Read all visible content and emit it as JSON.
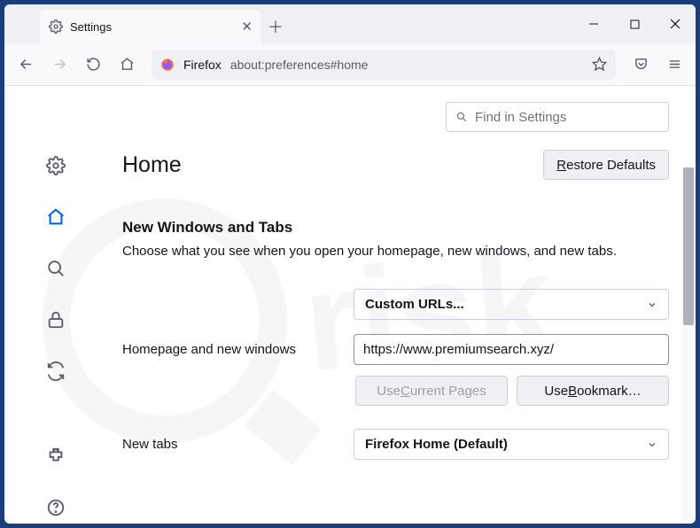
{
  "tab": {
    "title": "Settings"
  },
  "url": {
    "brand": "Firefox",
    "address": "about:preferences#home"
  },
  "search": {
    "placeholder": "Find in Settings"
  },
  "page": {
    "title": "Home",
    "restore": "Restore Defaults",
    "section_title": "New Windows and Tabs",
    "section_desc": "Choose what you see when you open your homepage, new windows, and new tabs.",
    "homepage_dropdown": "Custom URLs...",
    "homepage_label": "Homepage and new windows",
    "homepage_value": "https://www.premiumsearch.xyz/",
    "use_current_prefix": "Use ",
    "use_current_u": "C",
    "use_current_suffix": "urrent Pages",
    "use_bookmark_prefix": "Use ",
    "use_bookmark_u": "B",
    "use_bookmark_suffix": "ookmark…",
    "newtabs_label": "New tabs",
    "newtabs_dropdown": "Firefox Home (Default)",
    "restore_u": "R",
    "restore_suffix": "estore Defaults"
  }
}
